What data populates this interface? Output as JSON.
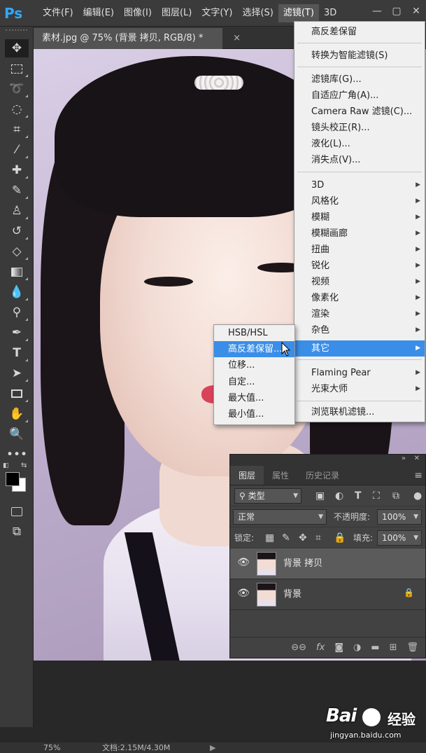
{
  "app": {
    "logo": "Ps"
  },
  "menubar": {
    "items": [
      "文件(F)",
      "编辑(E)",
      "图像(I)",
      "图层(L)",
      "文字(Y)",
      "选择(S)",
      "滤镜(T)",
      "3D"
    ],
    "active_index": 6
  },
  "document_tab": {
    "title": "素材.jpg @ 75% (背景 拷贝, RGB/8) *",
    "close": "×"
  },
  "filter_menu": {
    "items": [
      {
        "label": "高反差保留"
      },
      {
        "label": "转换为智能滤镜(S)"
      },
      {
        "label": "滤镜库(G)..."
      },
      {
        "label": "自适应广角(A)..."
      },
      {
        "label": "Camera Raw 滤镜(C)..."
      },
      {
        "label": "镜头校正(R)..."
      },
      {
        "label": "液化(L)..."
      },
      {
        "label": "消失点(V)..."
      },
      {
        "label": "3D"
      },
      {
        "label": "风格化"
      },
      {
        "label": "模糊"
      },
      {
        "label": "模糊画廊"
      },
      {
        "label": "扭曲"
      },
      {
        "label": "锐化"
      },
      {
        "label": "视频"
      },
      {
        "label": "像素化"
      },
      {
        "label": "渲染"
      },
      {
        "label": "杂色"
      },
      {
        "label": "其它"
      },
      {
        "label": "Flaming Pear"
      },
      {
        "label": "光束大师"
      },
      {
        "label": "浏览联机滤镜..."
      }
    ],
    "highlighted": "其它"
  },
  "other_submenu": {
    "items": [
      "HSB/HSL",
      "高反差保留...",
      "位移...",
      "自定...",
      "最大值...",
      "最小值..."
    ],
    "highlighted": "高反差保留..."
  },
  "layers_panel": {
    "tabs": [
      "图层",
      "属性",
      "历史记录"
    ],
    "active_tab": "图层",
    "filter_kind": "类型",
    "blend_mode": "正常",
    "opacity_label": "不透明度:",
    "opacity_value": "100%",
    "lock_label": "锁定:",
    "fill_label": "填充:",
    "fill_value": "100%",
    "layers": [
      {
        "name": "背景 拷贝",
        "selected": true,
        "locked": false
      },
      {
        "name": "背景",
        "selected": false,
        "locked": true
      }
    ]
  },
  "statusbar": {
    "zoom": "75%",
    "doc_info": "文档:2.15M/4.30M"
  },
  "watermark": {
    "brand": "Bai",
    "brand_cn": "经验",
    "url": "jingyan.baidu.com"
  },
  "colors": {
    "accent": "#3b8ee8",
    "ps_blue": "#31a8ff"
  }
}
